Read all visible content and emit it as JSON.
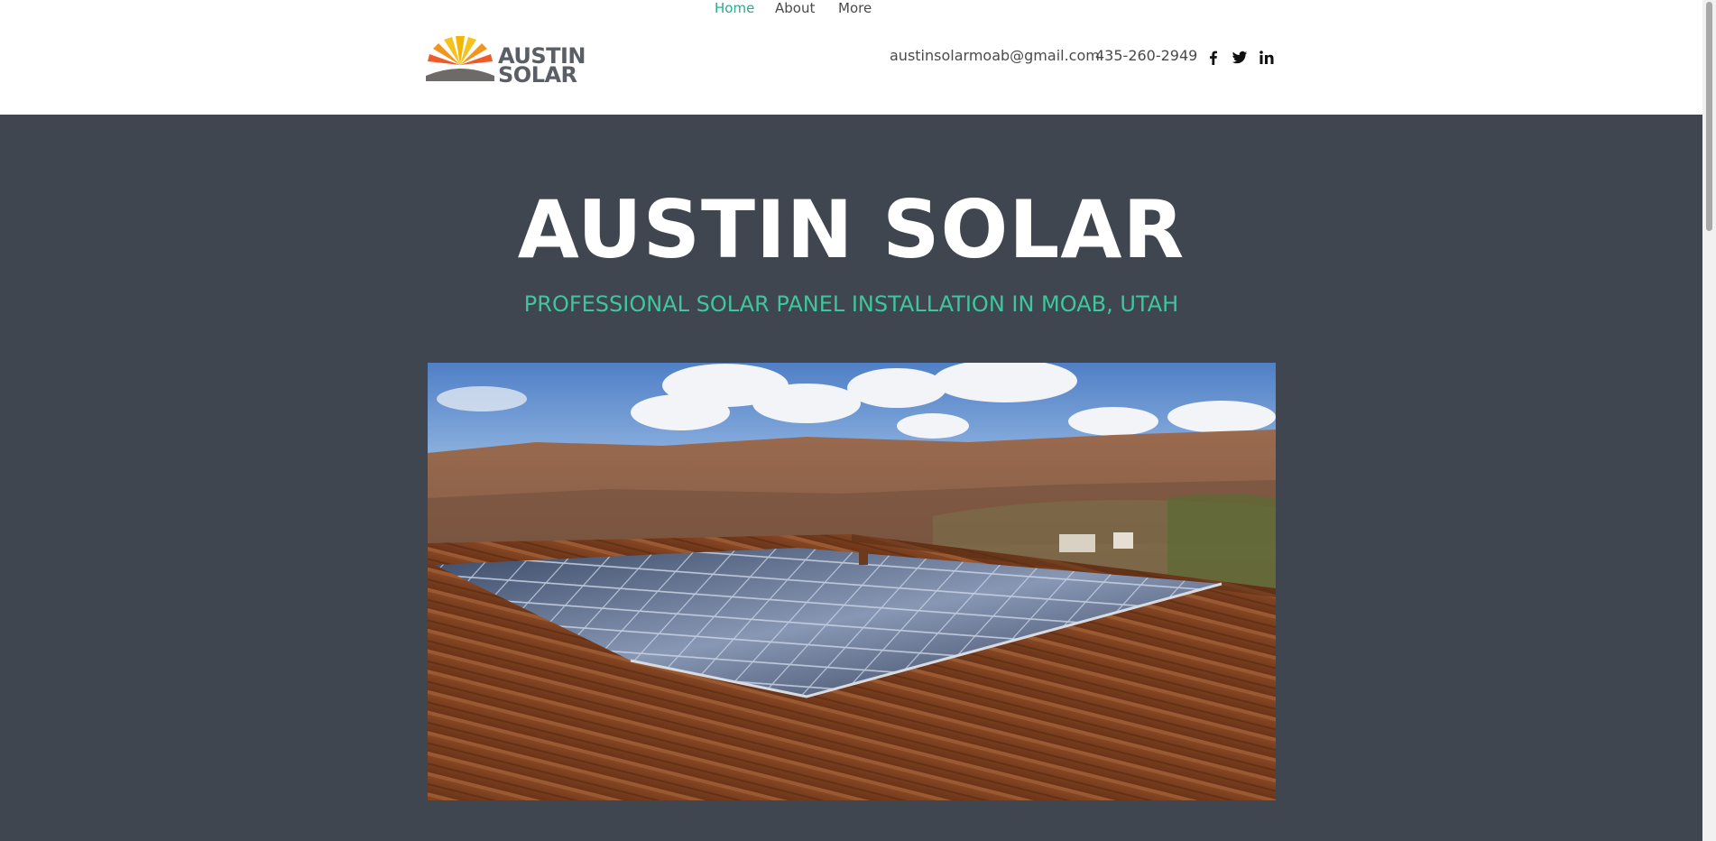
{
  "brand": {
    "line1": "AUSTIN",
    "line2": "SOLAR"
  },
  "nav": {
    "items": [
      {
        "label": "Home",
        "active": true
      },
      {
        "label": "About",
        "active": false
      },
      {
        "label": "More",
        "active": false
      }
    ]
  },
  "contact": {
    "email": "austinsolarmoab@gmail.com",
    "phone": "435-260-2949"
  },
  "social": [
    "facebook-icon",
    "twitter-icon",
    "linkedin-icon"
  ],
  "hero": {
    "title": "AUSTIN SOLAR",
    "subtitle": "PROFESSIONAL SOLAR PANEL INSTALLATION IN MOAB, UTAH"
  },
  "colors": {
    "background": "#3f4650",
    "accent": "#3fc69c",
    "nav_active": "#2bab8a",
    "header_bg": "#ffffff"
  }
}
